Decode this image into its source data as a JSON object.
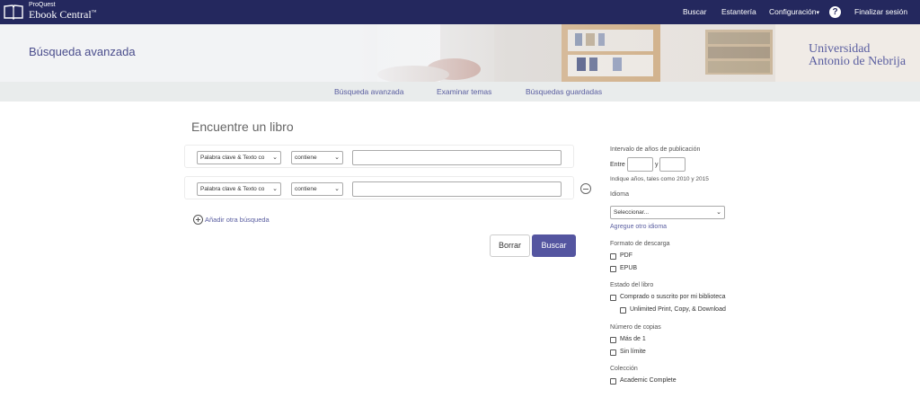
{
  "header": {
    "brand_small": "ProQuest",
    "brand_big": "Ebook Central",
    "brand_tm": "™",
    "nav": {
      "search": "Buscar",
      "shelf": "Estantería",
      "settings": "Configuración",
      "settings_caret": "▾",
      "help": "?",
      "logout": "Finalizar sesión"
    }
  },
  "banner": {
    "page_title": "Búsqueda avanzada",
    "university_line1": "Universidad",
    "university_line2": "Antonio de Nebrija"
  },
  "subnav": {
    "advanced": "Búsqueda avanzada",
    "browse": "Examinar temas",
    "saved": "Búsquedas guardadas"
  },
  "main": {
    "title": "Encuentre un libro",
    "rows": [
      {
        "field": "Palabra clave & Texto co",
        "operator": "contiene",
        "value": ""
      },
      {
        "field": "Palabra clave & Texto co",
        "operator": "contiene",
        "value": ""
      }
    ],
    "add_search": "Añadir otra búsqueda",
    "clear": "Borrar",
    "search": "Buscar"
  },
  "filters": {
    "years_label": "Intervalo de años de publicación",
    "between": "Entre",
    "and": "y",
    "years_hint": "Indique años, tales como 2010 y 2015",
    "language_label": "Idioma",
    "language_selected": "Seleccionar...",
    "add_language": "Agregue otro idioma",
    "format_label": "Formato de descarga",
    "format_pdf": "PDF",
    "format_epub": "EPUB",
    "status_label": "Estado del libro",
    "status_owned": "Comprado o suscrito por mi biblioteca",
    "status_unlimited": "Unlimited Print, Copy, & Download",
    "copies_label": "Número de copias",
    "copies_more": "Más de 1",
    "copies_unlimited": "Sin límite",
    "collection_label": "Colección",
    "collection_academic": "Academic Complete"
  },
  "colors": {
    "topbar": "#24285e",
    "accent": "#5455a0",
    "link": "#5a5ea0"
  }
}
